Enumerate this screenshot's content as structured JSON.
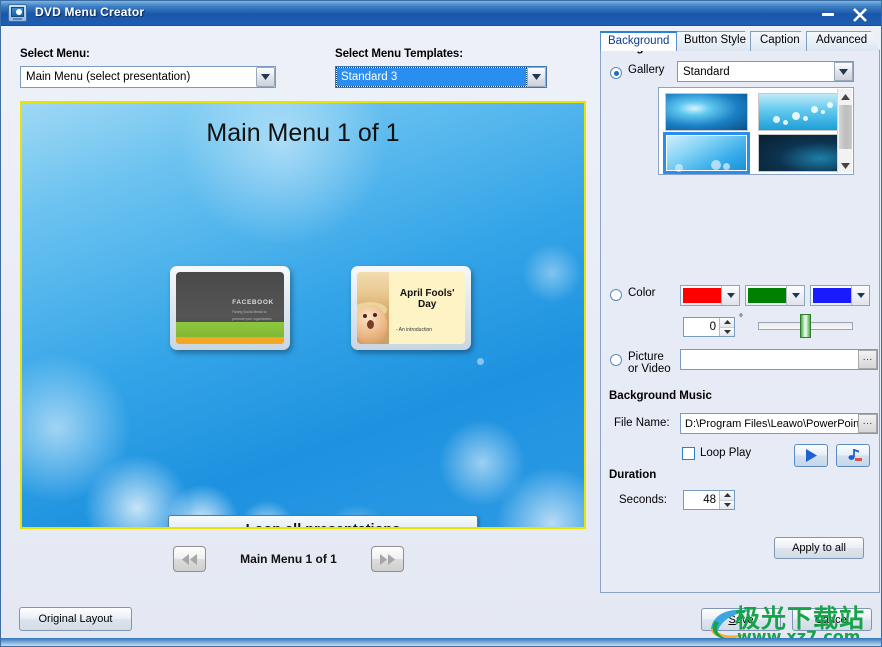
{
  "window": {
    "title": "DVD Menu Creator",
    "icon": "dvd-menu-icon",
    "minimize_label": "–",
    "close_label": "✕"
  },
  "left": {
    "select_menu_label": "Select Menu:",
    "select_menu_value": "Main Menu (select presentation)",
    "select_templates_label": "Select Menu Templates:",
    "select_templates_value": "Standard 3",
    "preview": {
      "title": "Main Menu 1 of 1",
      "thumb1": {
        "title": "FACEBOOK",
        "subtitle": "Facing Social Media to promote your organization"
      },
      "thumb2": {
        "title": "April Fools' Day",
        "subtitle": "- An introduction"
      },
      "loop_button": "Loop all presentations"
    },
    "nav": {
      "prev": "◀◀",
      "next": "▶▶",
      "label": "Main Menu 1 of 1"
    },
    "original_layout": "Original Layout"
  },
  "right": {
    "tabs": [
      {
        "label": "Background",
        "active": true
      },
      {
        "label": "Button Style",
        "active": false
      },
      {
        "label": "Caption",
        "active": false
      },
      {
        "label": "Advanced",
        "active": false
      }
    ],
    "background_section": "Background",
    "gallery_label": "Gallery",
    "gallery_value": "Standard",
    "gallery_selected_index": 2,
    "gallery_thumbs": [
      "blue-wisp",
      "blue-bokeh-dots",
      "light-blue-bokeh",
      "dark-teal-swirl"
    ],
    "color_label": "Color",
    "colors": [
      "#ff0000",
      "#008000",
      "#1a1aff"
    ],
    "angle_value": "0",
    "degree_symbol": "°",
    "slider_value": 45,
    "picture_label": "Picture or Video",
    "picture_value": "",
    "browse_label": "···",
    "music_section": "Background Music",
    "file_name_label": "File Name:",
    "file_name_value": "D:\\Program Files\\Leawo\\PowerPoin",
    "loop_play_label": "Loop Play",
    "loop_play_checked": false,
    "play_icon": "play-icon",
    "music_icon": "music-note-icon",
    "duration_section": "Duration",
    "seconds_label": "Seconds:",
    "seconds_value": "48",
    "apply_to_all": "Apply to all"
  },
  "footer": {
    "save": "Save",
    "save_accel": "S",
    "cancel": "Cancel",
    "cancel_accel": "C"
  },
  "watermark": {
    "text_cn": "极光下载站",
    "url": "www.xz7.com",
    "color": "#16a44a"
  }
}
